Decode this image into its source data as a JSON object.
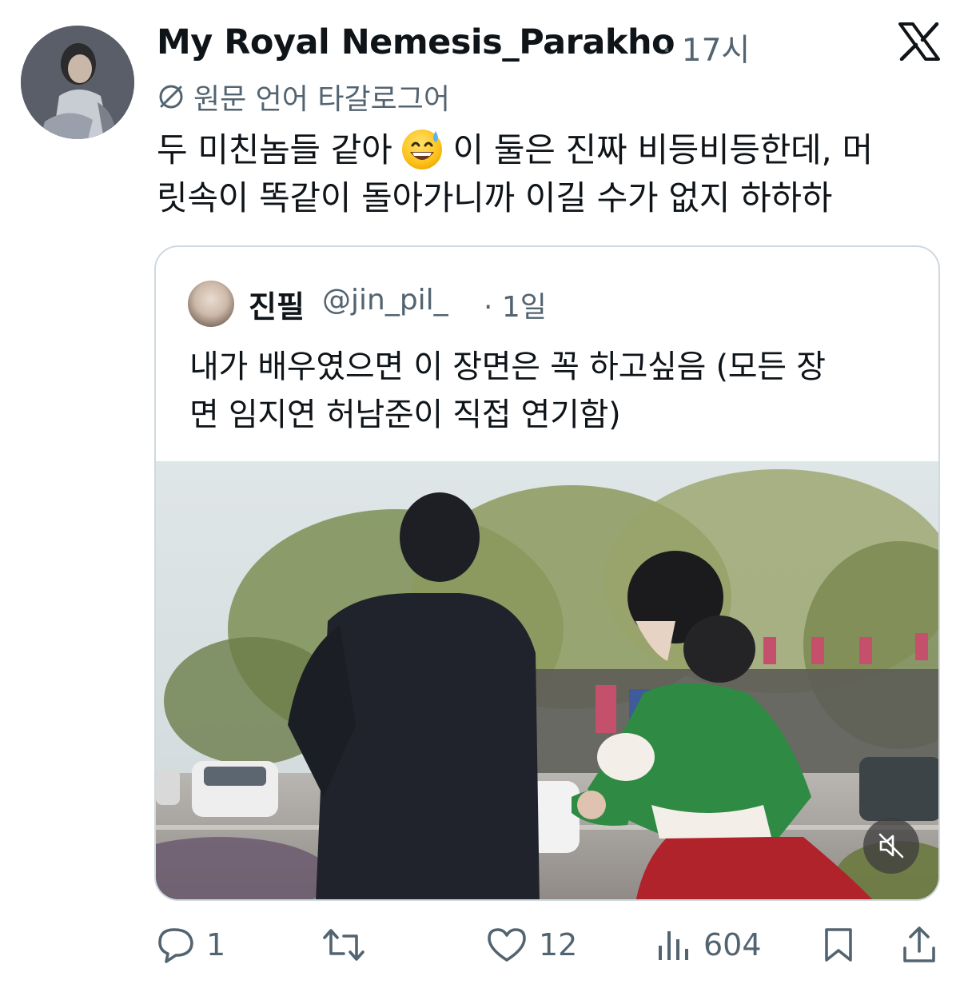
{
  "author": {
    "display_name": "My Royal Nemesis_Parakho",
    "time": "· 17시"
  },
  "translation": {
    "label": "원문 언어 타갈로그어"
  },
  "post": {
    "line1_before_emoji": "두 미친놈들 같아",
    "line1_after_emoji": "이 둘은 진짜 비등비등한데, 머",
    "line2": "릿속이 똑같이 돌아가니까 이길 수가 없지 하하하",
    "emoji": "grinning-face-with-sweat"
  },
  "quoted": {
    "name": "진필",
    "handle": "@jin_pil_",
    "time": "· 1일",
    "line1": "내가 배우였으면 이 장면은 꼭 하고싶음 (모든 장",
    "line2": "면 임지연 허남준이 직접 연기함)"
  },
  "actions": {
    "replies": "1",
    "reposts": "",
    "likes": "12",
    "views": "604"
  },
  "colors": {
    "text": "#0f1419",
    "secondary": "#536471",
    "border": "#cfd9de"
  }
}
